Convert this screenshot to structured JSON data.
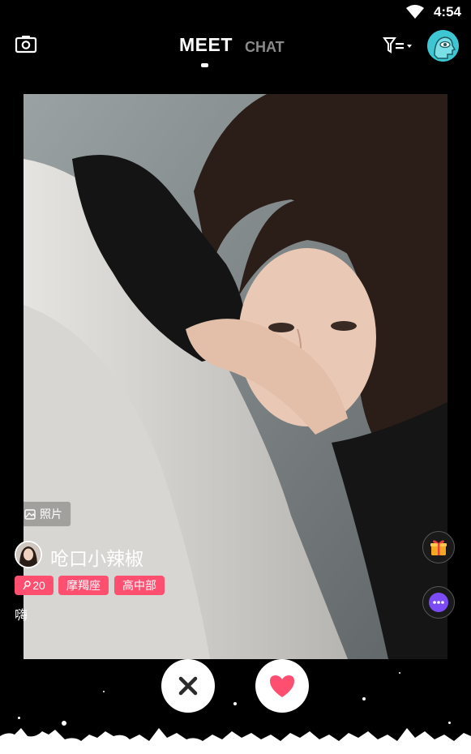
{
  "status_bar": {
    "time": "4:54",
    "wifi_icon": "wifi-icon"
  },
  "nav": {
    "camera_icon": "camera-icon",
    "tabs": [
      {
        "label": "MEET",
        "active": true
      },
      {
        "label": "CHAT",
        "active": false
      }
    ],
    "filter_icon": "filter-icon",
    "profile_avatar_icon": "eye-head-avatar-icon",
    "accent": "#39c3d1"
  },
  "card": {
    "photos_label": "照片",
    "username": "呛口小辣椒",
    "tags": {
      "age": "20",
      "zodiac": "摩羯座",
      "education": "高中部"
    },
    "bio": "嗨",
    "tag_color": "#ff4f70"
  },
  "actions": {
    "gift_icon": "gift-icon",
    "chat_icon": "chat-bubble-icon",
    "dislike_icon": "close-icon",
    "like_icon": "heart-icon",
    "like_color": "#ff4f70"
  }
}
